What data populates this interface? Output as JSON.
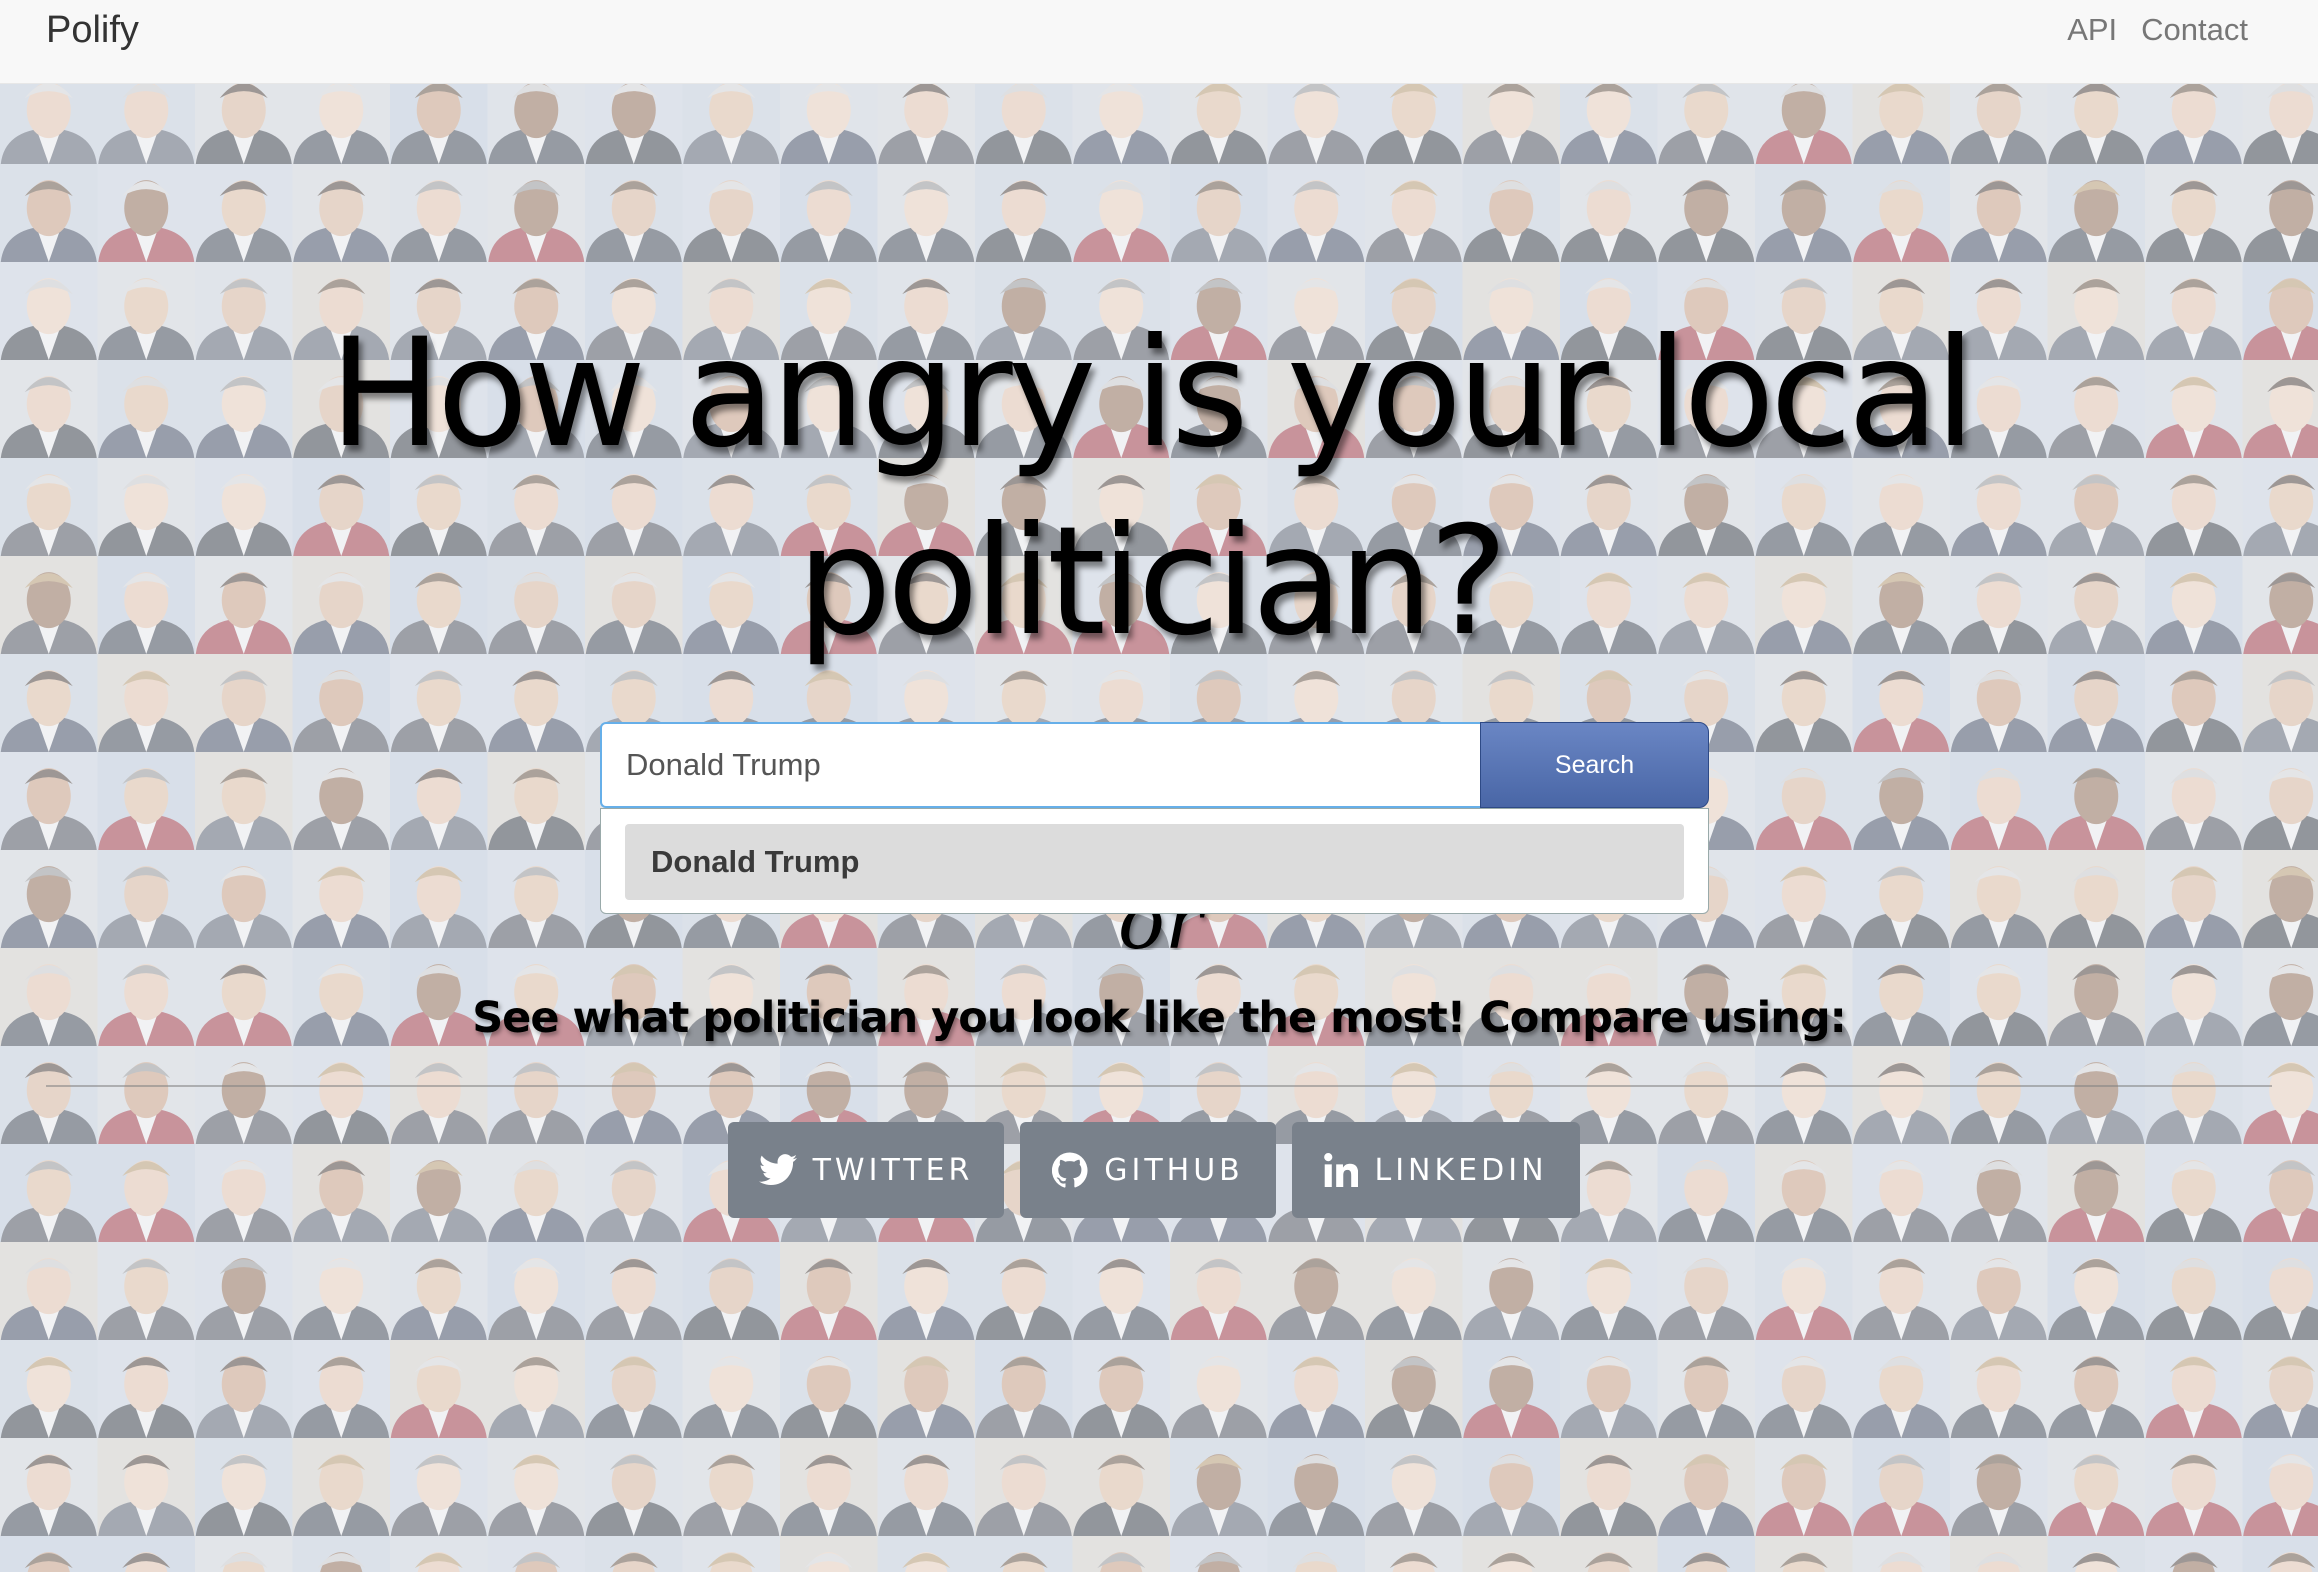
{
  "navbar": {
    "brand": "Polify",
    "links": [
      {
        "label": "API"
      },
      {
        "label": "Contact"
      }
    ]
  },
  "hero": {
    "title": "How angry is your local politician?",
    "or_text": "or",
    "subtitle": "See what politician you look like the most! Compare using:"
  },
  "search": {
    "value": "Donald Trump",
    "button_label": "Search",
    "suggestions": [
      {
        "label": "Donald Trump"
      }
    ]
  },
  "social": [
    {
      "label": "TWITTER",
      "icon": "twitter-icon"
    },
    {
      "label": "GITHUB",
      "icon": "github-icon"
    },
    {
      "label": "LINKEDIN",
      "icon": "linkedin-icon"
    }
  ],
  "colors": {
    "search_button": "#4966a6",
    "social_button": "#79818b",
    "navbar_bg": "#f8f8f8"
  }
}
